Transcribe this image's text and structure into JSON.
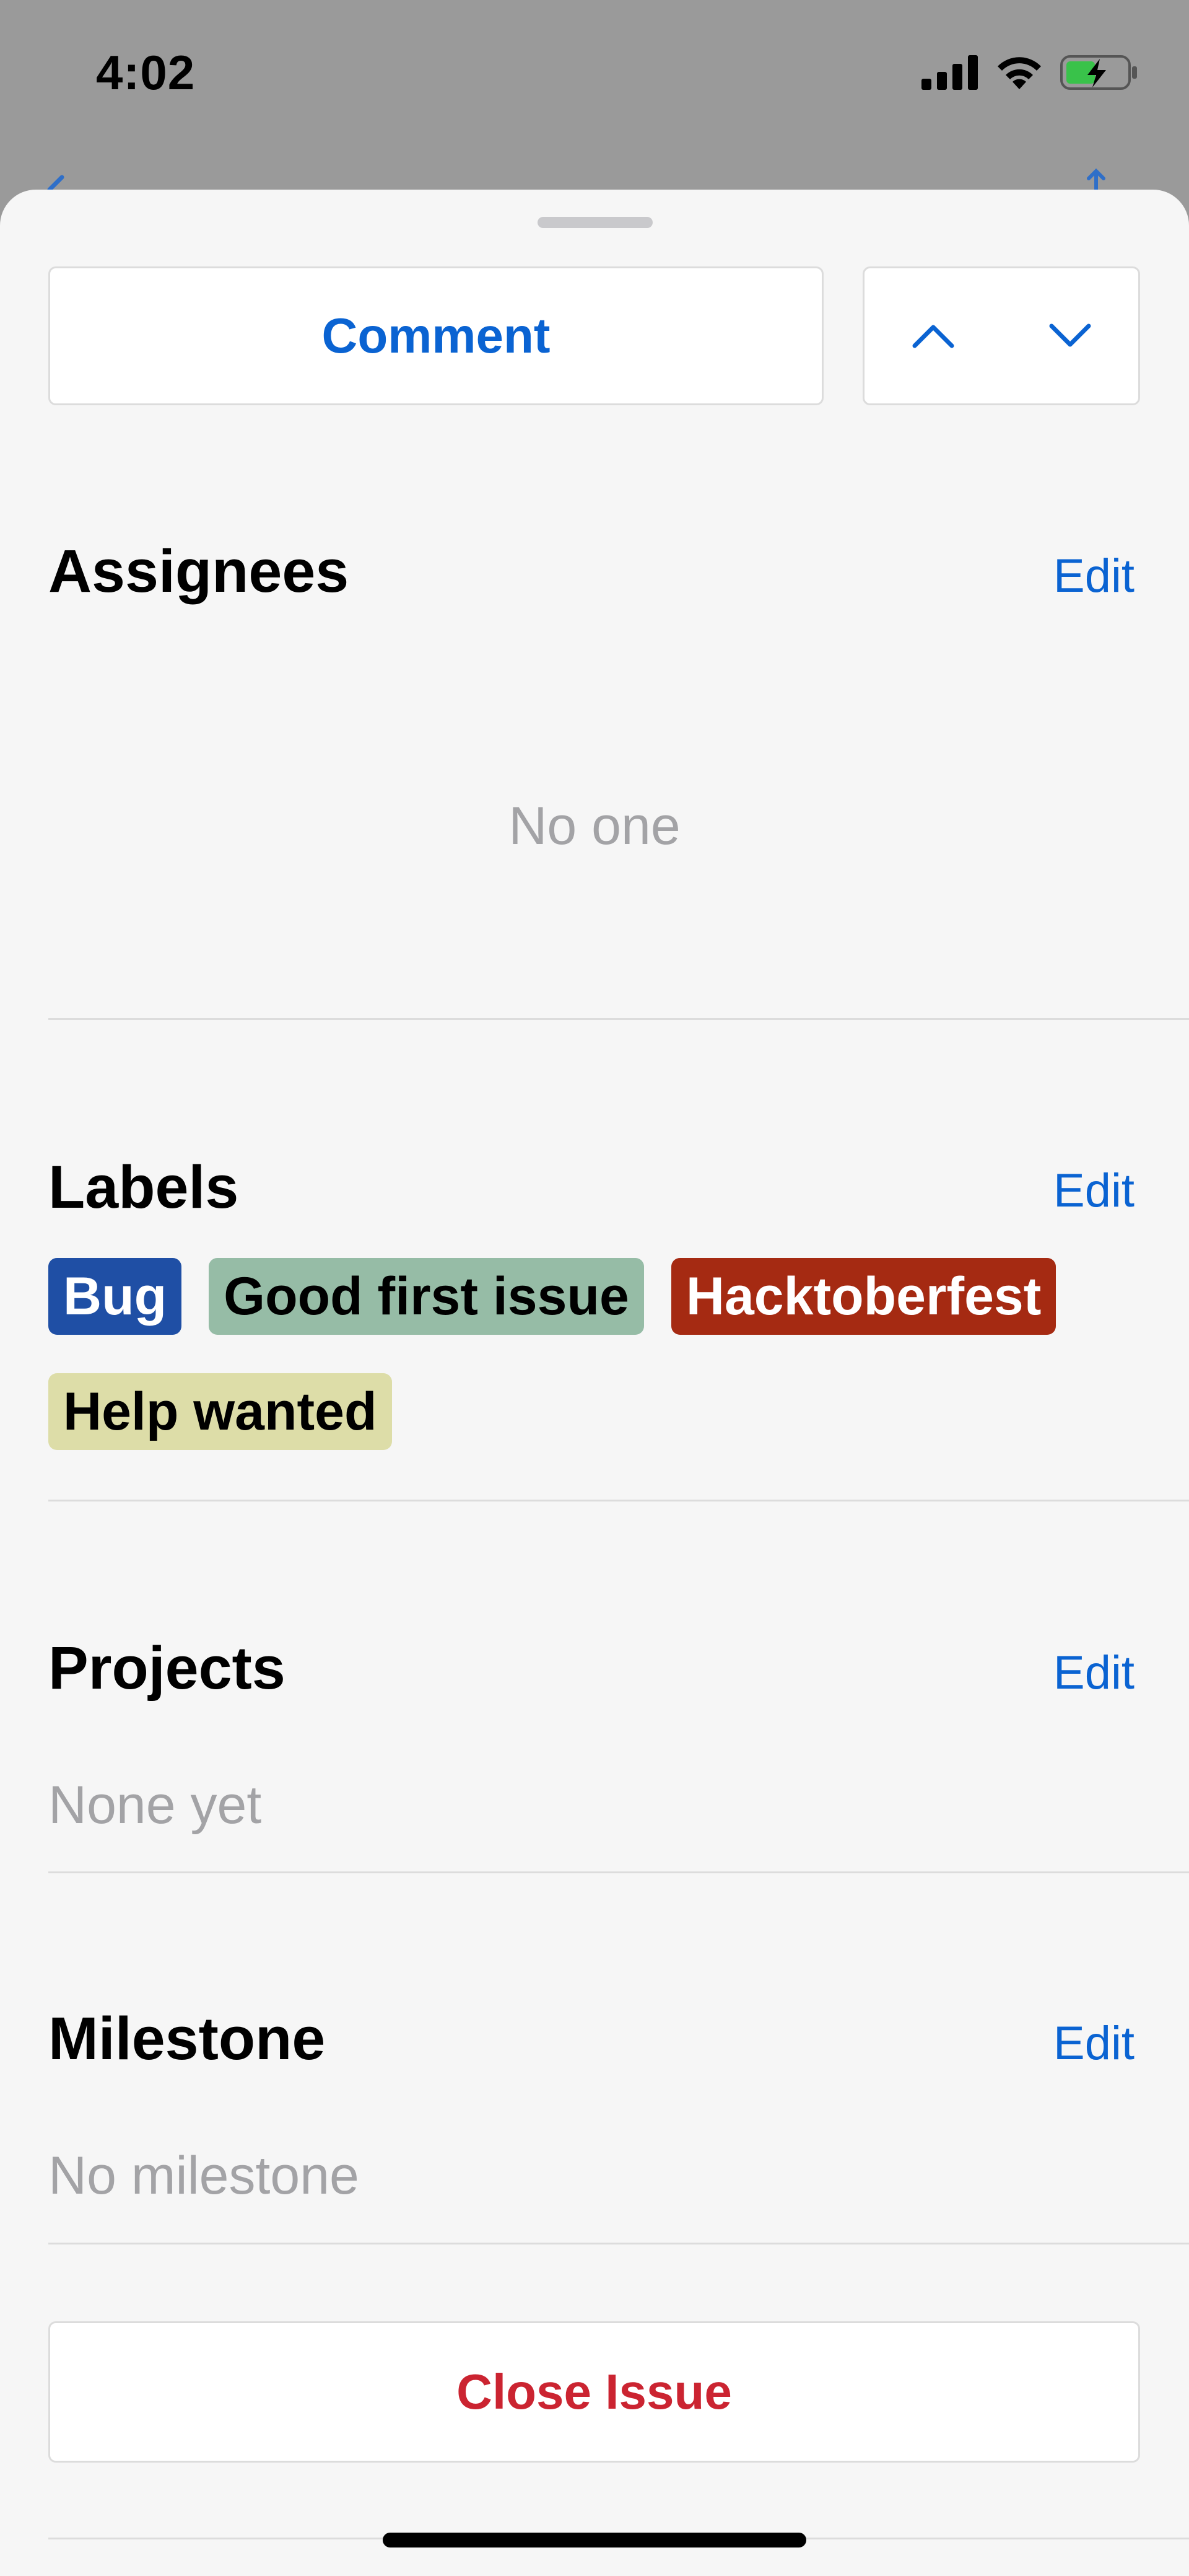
{
  "status_bar": {
    "time": "4:02",
    "icons": [
      "cellular-signal-icon",
      "wifi-icon",
      "battery-charging-icon"
    ]
  },
  "sheet": {
    "comment_label": "Comment",
    "nav": {
      "up_icon": "chevron-up-icon",
      "down_icon": "chevron-down-icon"
    },
    "assignees": {
      "title": "Assignees",
      "edit_label": "Edit",
      "empty_text": "No one"
    },
    "labels": {
      "title": "Labels",
      "edit_label": "Edit",
      "items": [
        {
          "name": "Bug",
          "color": "#1f4fa5",
          "text_color": "#ffffff"
        },
        {
          "name": "Good first issue",
          "color": "#96bca6",
          "text_color": "#000000"
        },
        {
          "name": "Hacktoberfest",
          "color": "#a52a12",
          "text_color": "#ffffff"
        },
        {
          "name": "Help wanted",
          "color": "#dddda8",
          "text_color": "#000000"
        }
      ]
    },
    "projects": {
      "title": "Projects",
      "edit_label": "Edit",
      "empty_text": "None yet"
    },
    "milestone": {
      "title": "Milestone",
      "edit_label": "Edit",
      "empty_text": "No milestone"
    },
    "close_label": "Close Issue"
  },
  "colors": {
    "accent": "#0a63d2",
    "danger": "#cb2431",
    "muted_text": "#a3a3a6",
    "sheet_bg": "#f6f6f6"
  }
}
